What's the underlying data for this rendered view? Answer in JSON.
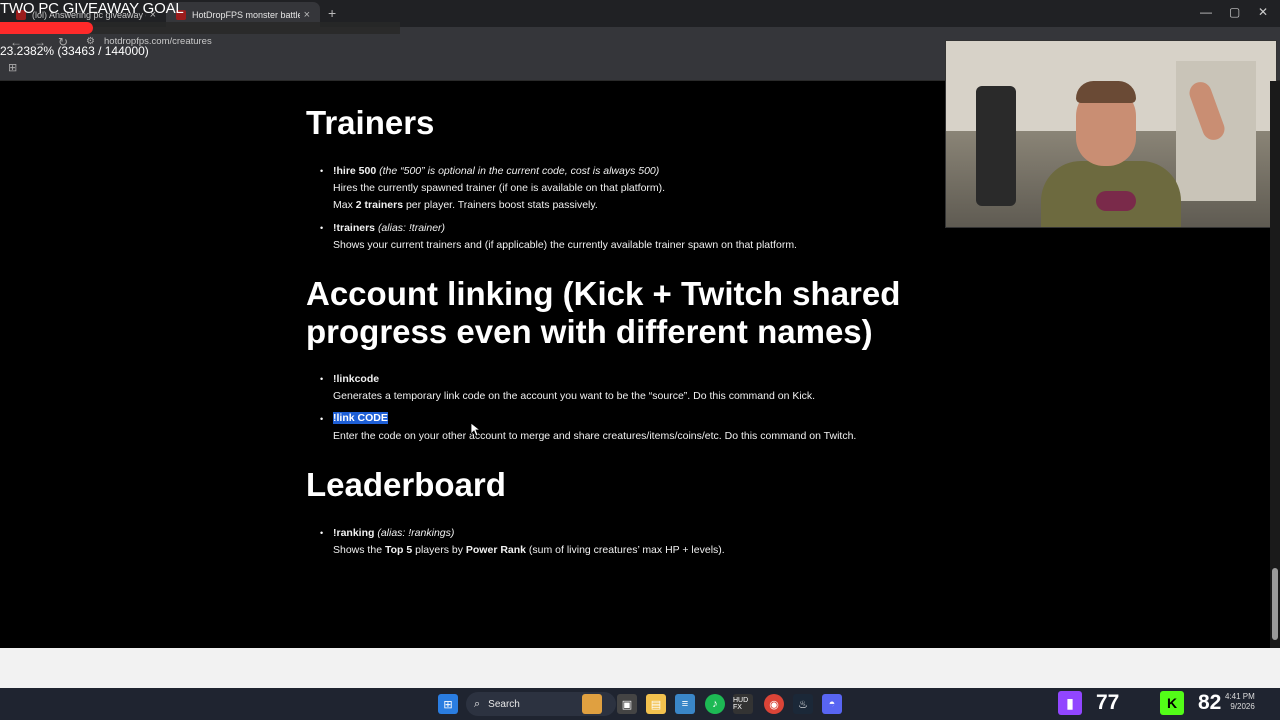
{
  "overlay": {
    "goal_title": "TWO PC GIVEAWAY GOAL",
    "goal_progress": "23.2382% (33463 / 144000)",
    "goal_fraction": 0.232382
  },
  "browser": {
    "tabs": [
      {
        "label": "(lol) Answering pc giveaway q…",
        "close": "×"
      },
      {
        "label": "HotDropFPS monster battle sty…",
        "close": "×"
      }
    ],
    "new_tab": "+",
    "url": "hotdropfps.com/creatures",
    "window_controls": [
      "—",
      "▢",
      "✕"
    ]
  },
  "page": {
    "sections": [
      {
        "heading": "Trainers",
        "commands": [
          {
            "name": "!hire 500",
            "note": "(the “500” is optional in the current code, cost is always 500)",
            "lines": [
              "Hires the currently spawned trainer (if one is available on that platform).",
              [
                "Max ",
                "2 trainers",
                " per player. Trainers boost stats passively."
              ]
            ]
          },
          {
            "name": "!trainers",
            "note": "(alias: !trainer)",
            "lines": [
              "Shows your current trainers and (if applicable) the currently available trainer spawn on that platform."
            ]
          }
        ]
      },
      {
        "heading_line1": "Account linking (Kick + Twitch shared",
        "heading_line2": "progress even with different names)",
        "commands": [
          {
            "name": "!linkcode",
            "lines": [
              "Generates a temporary link code on the account you want to be the “source”. Do this command on Kick."
            ]
          },
          {
            "name": "!link CODE",
            "lines": [
              "Enter the code on your other account to merge and share creatures/items/coins/etc. Do this command on Twitch."
            ]
          }
        ]
      },
      {
        "heading": "Leaderboard",
        "commands": [
          {
            "name": "!ranking",
            "note": "(alias: !rankings)",
            "line_parts": [
              "Shows the ",
              "Top 5",
              " players by ",
              "Power Rank",
              " (sum of living creatures’ max HP + levels)."
            ]
          }
        ]
      }
    ]
  },
  "taskbar": {
    "search_label": "Search",
    "twitch_count": "77",
    "kick_count": "82",
    "kick_badge": "K",
    "clock_time": "4:41 PM",
    "clock_date": "9/2026",
    "hud_label": "HUD FX"
  },
  "colors": {
    "selection": "#1e5fd6",
    "twitch": "#9146ff",
    "kick": "#53fc18"
  }
}
